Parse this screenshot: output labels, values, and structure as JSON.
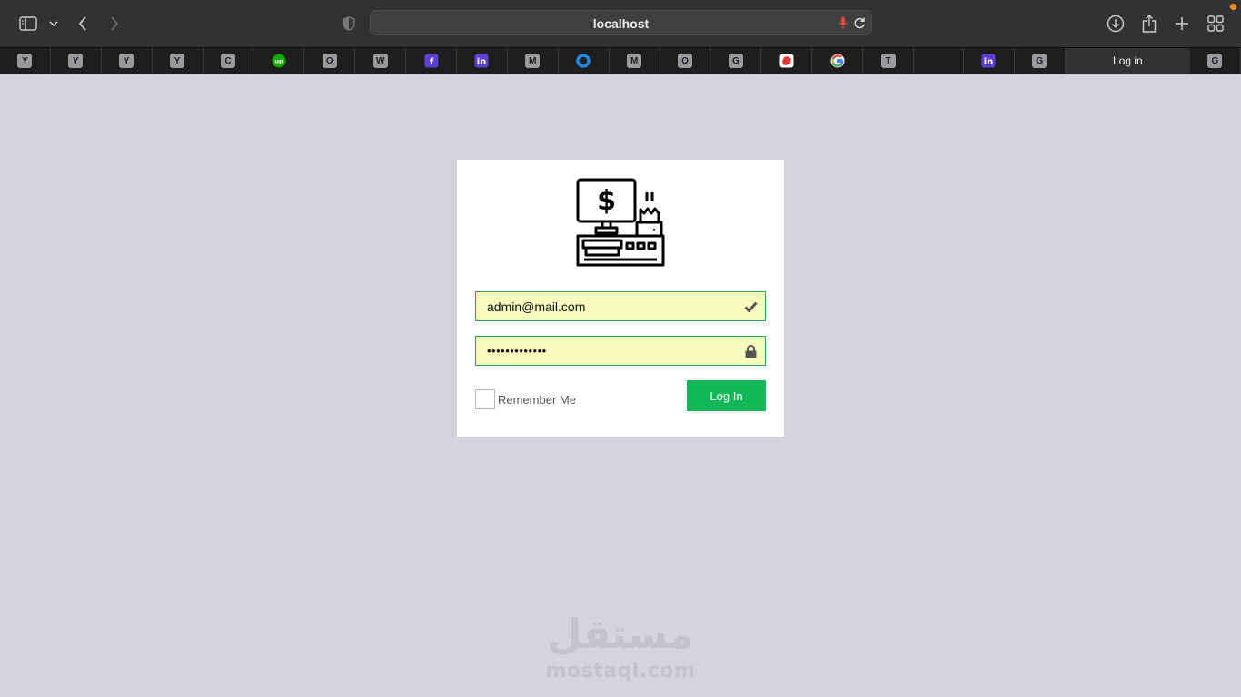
{
  "browser": {
    "url": "localhost",
    "tabs": [
      {
        "kind": "letter",
        "letter": "Y",
        "icon": "y-favicon"
      },
      {
        "kind": "letter",
        "letter": "Y",
        "icon": "y-favicon"
      },
      {
        "kind": "letter",
        "letter": "Y",
        "icon": "y-favicon"
      },
      {
        "kind": "letter",
        "letter": "Y",
        "icon": "y-favicon"
      },
      {
        "kind": "letter",
        "letter": "C",
        "icon": "c-favicon"
      },
      {
        "kind": "svg",
        "icon": "upwork-favicon",
        "letter": "up",
        "color": "#14a800"
      },
      {
        "kind": "letter",
        "letter": "O",
        "icon": "o-favicon"
      },
      {
        "kind": "letter",
        "letter": "W",
        "icon": "w-favicon"
      },
      {
        "kind": "svg",
        "icon": "facebook-favicon",
        "letter": "f",
        "color": "#5d3fd3"
      },
      {
        "kind": "svg",
        "icon": "linkedin-favicon",
        "letter": "in",
        "color": "#5d3fd3"
      },
      {
        "kind": "letter",
        "letter": "M",
        "icon": "m-favicon"
      },
      {
        "kind": "svg",
        "icon": "ring-favicon",
        "color": "#1e88e5"
      },
      {
        "kind": "letter",
        "letter": "M",
        "icon": "m-favicon"
      },
      {
        "kind": "letter",
        "letter": "O",
        "icon": "o-favicon"
      },
      {
        "kind": "letter",
        "letter": "G",
        "icon": "g-favicon"
      },
      {
        "kind": "svg",
        "icon": "red-app-favicon",
        "color": "#e53935"
      },
      {
        "kind": "svg",
        "icon": "google-favicon"
      },
      {
        "kind": "letter",
        "letter": "T",
        "icon": "t-favicon"
      },
      {
        "kind": "spacer"
      },
      {
        "kind": "svg",
        "icon": "linkedin-favicon",
        "letter": "in",
        "color": "#5d3fd3"
      },
      {
        "kind": "letter",
        "letter": "G",
        "icon": "g-favicon"
      },
      {
        "kind": "active",
        "title": "Log in"
      },
      {
        "kind": "letter",
        "letter": "G",
        "icon": "g-favicon"
      }
    ]
  },
  "login": {
    "logo_icon": "cash-register-icon",
    "email_value": "admin@mail.com",
    "email_icon": "checkmark-icon",
    "password_value": "•••••••••••••",
    "password_icon": "lock-icon",
    "remember_label": "Remember Me",
    "login_button": "Log In"
  },
  "watermark": {
    "arabic": "مستقل",
    "latin": "mostaql.com"
  },
  "colors": {
    "page_bg": "#d4d4e0",
    "field_bg": "#f5fcbd",
    "field_border": "#2fa655",
    "button_bg": "#12b757"
  }
}
